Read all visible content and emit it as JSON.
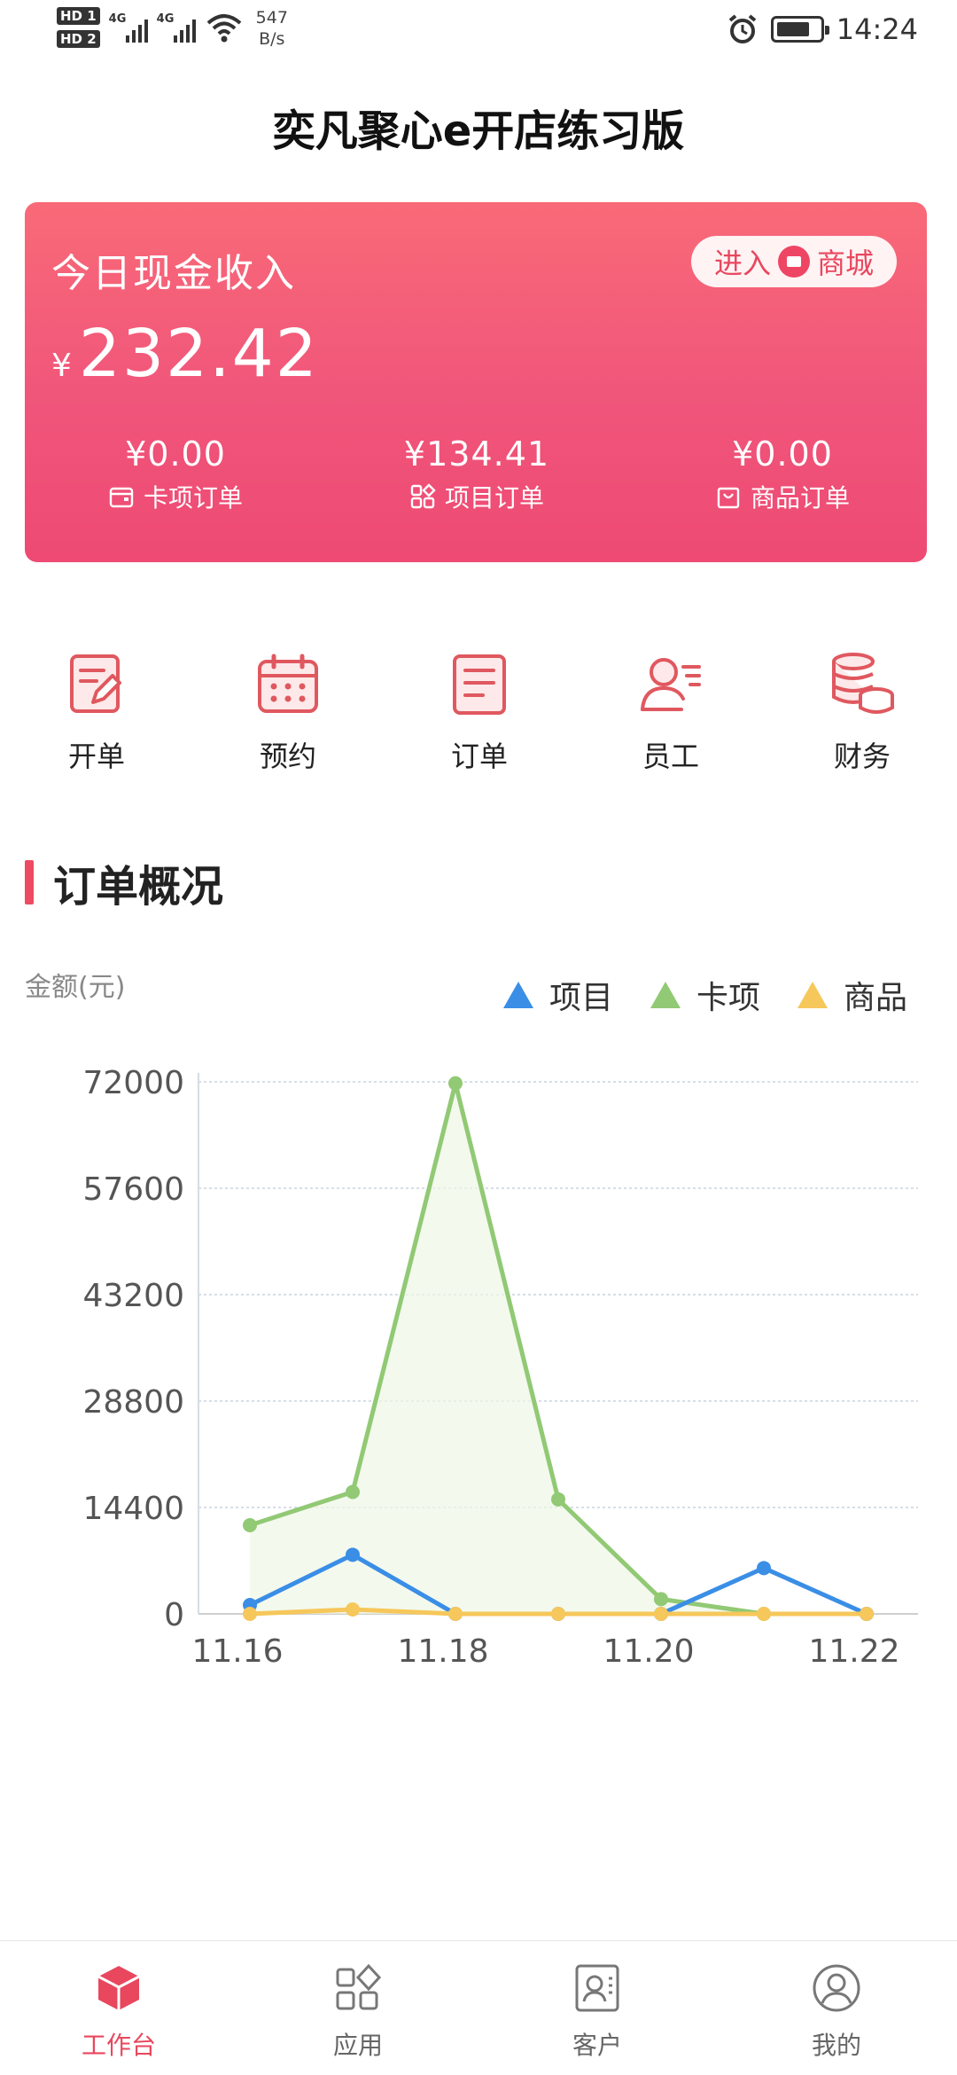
{
  "status_bar": {
    "hd1": "HD 1",
    "hd2": "HD 2",
    "net1": "4G",
    "net2": "4G",
    "speed_value": "547",
    "speed_unit": "B/s",
    "time": "14:24",
    "icons": [
      "signal-icon",
      "wifi-icon",
      "alarm-icon",
      "battery-icon"
    ]
  },
  "header": {
    "title": "奕凡聚心e开店练习版"
  },
  "income_card": {
    "label": "今日现金收入",
    "currency": "¥",
    "amount": "232.42",
    "mall_button": {
      "enter": "进入",
      "mall": "商城"
    },
    "stats": [
      {
        "value": "¥0.00",
        "label": "卡项订单",
        "icon": "card-icon"
      },
      {
        "value": "¥134.41",
        "label": "项目订单",
        "icon": "grid-icon"
      },
      {
        "value": "¥0.00",
        "label": "商品订单",
        "icon": "bag-icon"
      }
    ],
    "colors": {
      "gradient_top": "#f96a78",
      "gradient_bottom": "#ee4a73"
    }
  },
  "quick_menu": [
    {
      "label": "开单",
      "icon": "edit-doc-icon"
    },
    {
      "label": "预约",
      "icon": "calendar-icon"
    },
    {
      "label": "订单",
      "icon": "list-doc-icon"
    },
    {
      "label": "员工",
      "icon": "staff-icon"
    },
    {
      "label": "财务",
      "icon": "coins-icon"
    }
  ],
  "section": {
    "title": "订单概况"
  },
  "chart_data": {
    "type": "line",
    "ylabel": "金额(元)",
    "ylim": [
      0,
      72000
    ],
    "yticks": [
      "72000",
      "57600",
      "43200",
      "28800",
      "14400",
      "0"
    ],
    "x": [
      "11.16",
      "11.17",
      "11.18",
      "11.19",
      "11.20",
      "11.21",
      "11.22"
    ],
    "xtick_labels": [
      "11.16",
      "11.18",
      "11.20",
      "11.22"
    ],
    "grid": true,
    "legend_position": "top-right",
    "series": [
      {
        "name": "项目",
        "color": "#3a8ee6",
        "values": [
          1200,
          8000,
          0,
          0,
          0,
          6200,
          0
        ]
      },
      {
        "name": "卡项",
        "color": "#91c974",
        "values": [
          12000,
          16500,
          71800,
          15500,
          2000,
          0,
          0
        ]
      },
      {
        "name": "商品",
        "color": "#f6c75a",
        "values": [
          0,
          600,
          0,
          0,
          0,
          0,
          0
        ]
      }
    ]
  },
  "tab_bar": {
    "active_color": "#e8475e",
    "tabs": [
      {
        "label": "工作台",
        "icon": "cube-icon",
        "active": true
      },
      {
        "label": "应用",
        "icon": "apps-icon",
        "active": false
      },
      {
        "label": "客户",
        "icon": "contact-card-icon",
        "active": false
      },
      {
        "label": "我的",
        "icon": "profile-icon",
        "active": false
      }
    ]
  }
}
